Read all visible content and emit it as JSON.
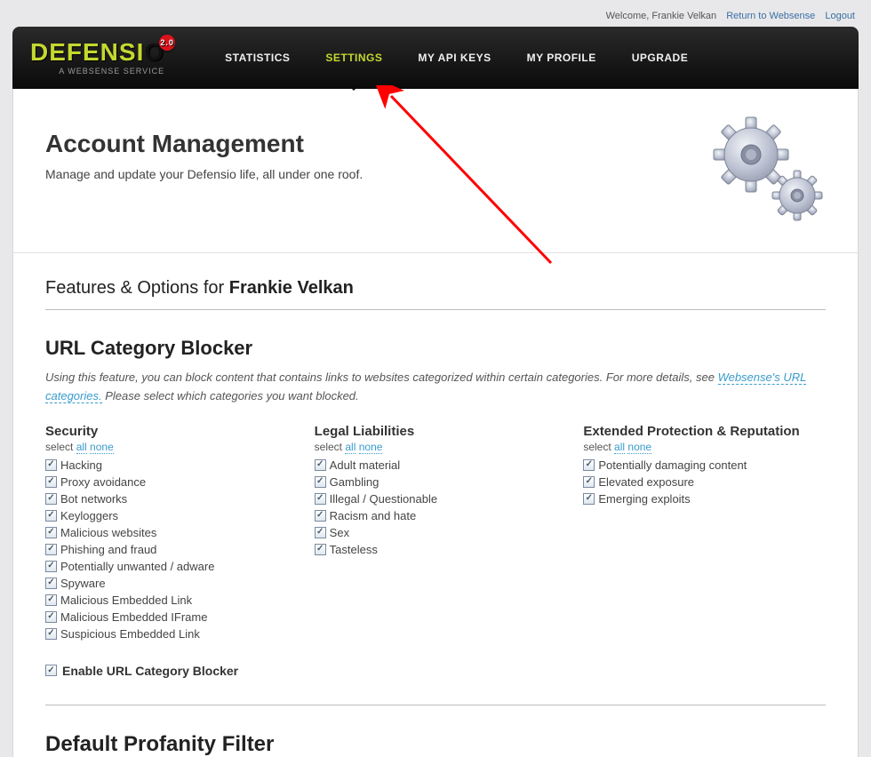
{
  "top_utility": {
    "welcome": "Welcome, Frankie Velkan",
    "link1": "Return to Websense",
    "link2": "Logout"
  },
  "logo": {
    "text": "DEFENSIO",
    "tagline": "A WEBSENSE SERVICE",
    "badge": "2.0"
  },
  "nav": [
    {
      "label": "STATISTICS",
      "active": false
    },
    {
      "label": "SETTINGS",
      "active": true
    },
    {
      "label": "MY API KEYS",
      "active": false
    },
    {
      "label": "MY PROFILE",
      "active": false
    },
    {
      "label": "UPGRADE",
      "active": false
    }
  ],
  "intro": {
    "title": "Account Management",
    "subtitle": "Manage and update your Defensio life, all under one roof."
  },
  "features": {
    "prefix": "Features & Options for ",
    "name": "Frankie Velkan"
  },
  "url_blocker": {
    "title": "URL Category Blocker",
    "desc1": "Using this feature, you can block content that contains links to websites categorized within certain categories. For more details, see ",
    "link_text": "Websense's URL categories.",
    "desc2": " Please select which categories you want blocked.",
    "select_label": "select",
    "sel_all": "all",
    "sel_none": "none",
    "columns": [
      {
        "title": "Security",
        "items": [
          "Hacking",
          "Proxy avoidance",
          "Bot networks",
          "Keyloggers",
          "Malicious websites",
          "Phishing and fraud",
          "Potentially unwanted / adware",
          "Spyware",
          "Malicious Embedded Link",
          "Malicious Embedded IFrame",
          "Suspicious Embedded Link"
        ]
      },
      {
        "title": "Legal Liabilities",
        "items": [
          "Adult material",
          "Gambling",
          "Illegal / Questionable",
          "Racism and hate",
          "Sex",
          "Tasteless"
        ]
      },
      {
        "title": "Extended Protection & Reputation",
        "items": [
          "Potentially damaging content",
          "Elevated exposure",
          "Emerging exploits"
        ]
      }
    ],
    "enable_label": "Enable URL Category Blocker"
  },
  "profanity": {
    "title": "Default Profanity Filter"
  }
}
